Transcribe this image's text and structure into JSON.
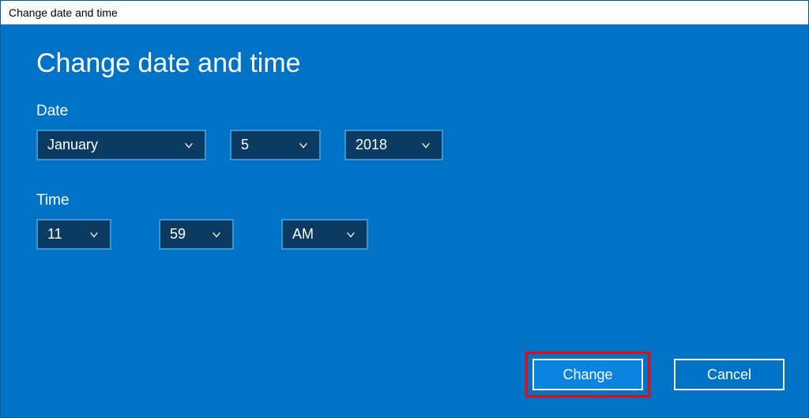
{
  "window": {
    "title": "Change date and time"
  },
  "heading": "Change date and time",
  "labels": {
    "date": "Date",
    "time": "Time"
  },
  "date": {
    "month": "January",
    "day": "5",
    "year": "2018"
  },
  "time": {
    "hour": "11",
    "minute": "59",
    "ampm": "AM"
  },
  "buttons": {
    "change": "Change",
    "cancel": "Cancel"
  }
}
